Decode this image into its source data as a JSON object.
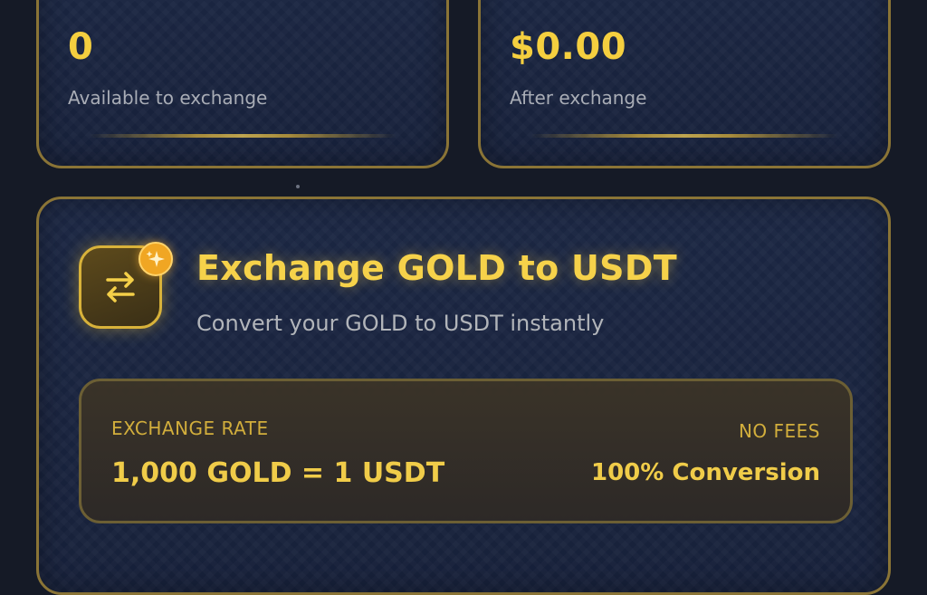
{
  "balance_card": {
    "value": "0",
    "subtitle": "Available to exchange"
  },
  "value_card": {
    "value": "$0.00",
    "subtitle": "After exchange"
  },
  "exchange_card": {
    "title": "Exchange GOLD to USDT",
    "subtitle": "Convert your GOLD to USDT instantly",
    "icon": "swap-arrows-icon",
    "badge_icon": "sparkle-icon",
    "rate": {
      "label": "EXCHANGE RATE",
      "value": "1,000 GOLD = 1 USDT",
      "fees_label": "NO FEES",
      "conversion": "100% Conversion"
    }
  },
  "colors": {
    "accent_gold": "#f6d24a",
    "card_border": "#8a7436",
    "background": "#151a26",
    "badge_orange": "#f0a623"
  }
}
